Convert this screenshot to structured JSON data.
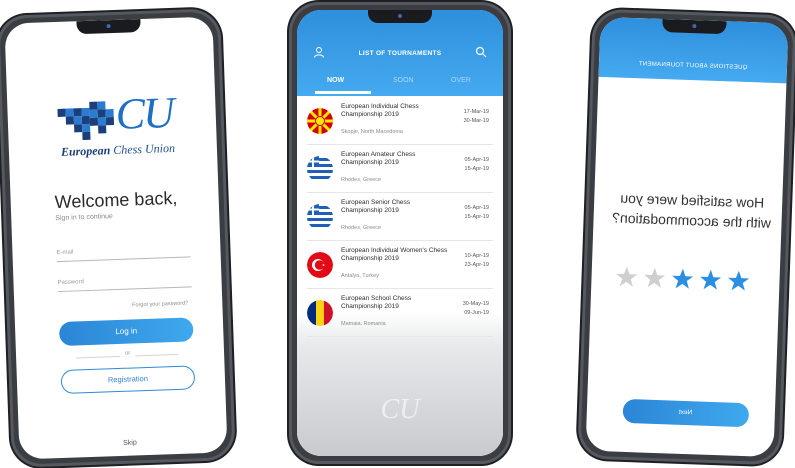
{
  "login": {
    "logo_mark": "ECU",
    "logo_org_bold": "European",
    "logo_org_rest": "Chess Union",
    "welcome": "Welcome back,",
    "signin_hint": "Sign in to continue",
    "email_placeholder": "E-mail",
    "password_placeholder": "Password",
    "forgot_link": "Forgot your password?",
    "login_button": "Log in",
    "or_text": "or",
    "registration_button": "Registration",
    "skip_link": "Skip"
  },
  "tournaments": {
    "title": "LIST OF TOURNAMENTS",
    "tabs": [
      {
        "label": "NOW",
        "active": true
      },
      {
        "label": "SOON",
        "active": false
      },
      {
        "label": "OVER",
        "active": false
      }
    ],
    "items": [
      {
        "name": "European Individual Chess Championship 2019",
        "location": "Skopje, North Macedonia",
        "start": "17-Mar-19",
        "end": "30-Mar-19",
        "flag": "north-macedonia-flag-icon"
      },
      {
        "name": "European Amateur Chess Championship 2019",
        "location": "Rhodes, Greece",
        "start": "05-Apr-19",
        "end": "15-Apr-19",
        "flag": "greece-flag-icon"
      },
      {
        "name": "European Senior Chess Championship 2019",
        "location": "Rhodes, Greece",
        "start": "05-Apr-19",
        "end": "15-Apr-19",
        "flag": "greece-flag-icon"
      },
      {
        "name": "European Individual Women's Chess Championship 2019",
        "location": "Antalya, Turkey",
        "start": "10-Apr-19",
        "end": "23-Apr-19",
        "flag": "turkey-flag-icon"
      },
      {
        "name": "European School Chess Championship 2019",
        "location": "Mamaia, Romania",
        "start": "30-May-19",
        "end": "09-Jun-19",
        "flag": "romania-flag-icon"
      }
    ],
    "footer_logo": "CU",
    "colors": {
      "header": "#2e8fdc",
      "accent": "#45aaf0"
    }
  },
  "survey": {
    "title": "QUESTIONS ABOUT TOURNAMENT",
    "question": "How satisfied were you with the accommodation?",
    "rating": 3,
    "rating_max": 5,
    "next_button": "Next",
    "colors": {
      "star_active": "#2b8ee2",
      "star_inactive": "#cfcfcf"
    }
  }
}
